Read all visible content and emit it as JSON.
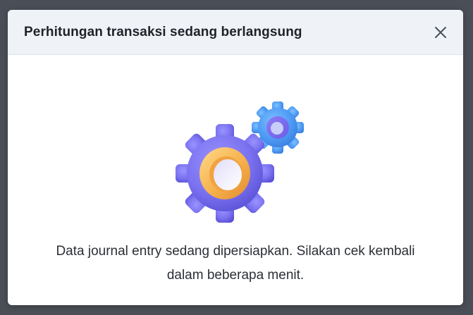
{
  "modal": {
    "title": "Perhitungan transaksi sedang berlangsung",
    "message_line1": "Data journal entry sedang dipersiapkan. Silakan cek kembali",
    "message_line2": "dalam beberapa menit."
  },
  "icons": {
    "close": "close-icon",
    "illustration": "gears-illustration"
  },
  "colors": {
    "backdrop": "#4a4f57",
    "header_bg": "#eff3f8",
    "gear_large": "#7b73f0",
    "gear_small": "#4f9cf5",
    "gear_ring": "#f5b14c"
  }
}
